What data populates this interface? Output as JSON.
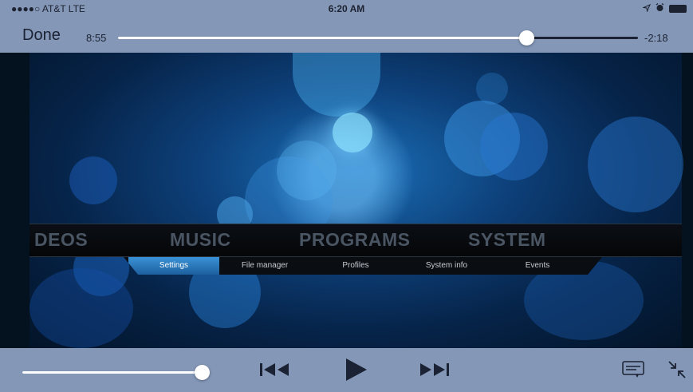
{
  "status_bar": {
    "carrier": "●●●●○ AT&T  LTE",
    "time": "6:20 AM"
  },
  "player": {
    "done_label": "Done",
    "elapsed": "8:55",
    "remaining": "-2:18",
    "progress": 0.786,
    "volume": 0.98,
    "accent_color": "#1a2233"
  },
  "kodi_menu": {
    "items": [
      "DEOS",
      "MUSIC",
      "PROGRAMS",
      "SYSTEM"
    ],
    "subitems": [
      "Settings",
      "File manager",
      "Profiles",
      "System info",
      "Events"
    ],
    "active_subitem": "Settings"
  },
  "icons": {
    "location": "location-arrow-icon",
    "alarm": "alarm-icon",
    "battery": "battery-icon",
    "previous": "skip-back-icon",
    "play": "play-icon",
    "next": "skip-forward-icon",
    "subtitles": "subtitles-icon",
    "exit_fullscreen": "exit-fullscreen-icon"
  }
}
